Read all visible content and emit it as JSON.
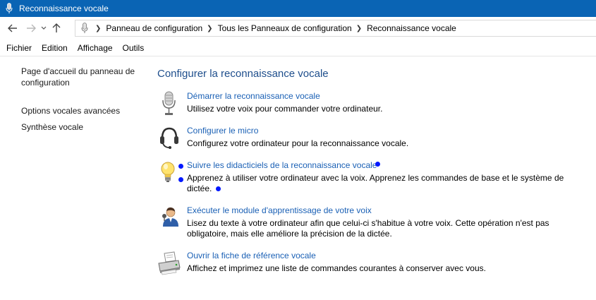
{
  "window": {
    "title": "Reconnaissance vocale"
  },
  "breadcrumb": [
    "Panneau de configuration",
    "Tous les Panneaux de configuration",
    "Reconnaissance vocale"
  ],
  "menu": [
    "Fichier",
    "Edition",
    "Affichage",
    "Outils"
  ],
  "sidebar": {
    "items": [
      {
        "label": "Page d'accueil du panneau de configuration"
      },
      {
        "label": "Options vocales avancées"
      },
      {
        "label": "Synthèse vocale"
      }
    ]
  },
  "main": {
    "heading": "Configurer la reconnaissance vocale",
    "tasks": [
      {
        "icon": "microphone-icon",
        "link": "Démarrer la reconnaissance vocale",
        "desc": "Utilisez votre voix pour commander votre ordinateur."
      },
      {
        "icon": "headset-icon",
        "link": "Configurer le micro",
        "desc": "Configurez votre ordinateur pour la reconnaissance vocale."
      },
      {
        "icon": "lightbulb-icon",
        "link": "Suivre les didacticiels de la reconnaissance vocale",
        "desc": "Apprenez à utiliser votre ordinateur avec la voix. Apprenez les commandes de base et le système de dictée."
      },
      {
        "icon": "voice-training-icon",
        "link": "Exécuter le module d'apprentissage de votre voix",
        "desc": "Lisez du texte à votre ordinateur afin que celui-ci s'habitue à votre voix. Cette opération n'est pas obligatoire, mais elle améliore la précision de la dictée."
      },
      {
        "icon": "printer-icon",
        "link": "Ouvrir la fiche de référence vocale",
        "desc": "Affichez et imprimez une liste de commandes courantes à conserver avec vous."
      }
    ]
  },
  "colors": {
    "titlebar": "#0a64b4",
    "link": "#1a60b5",
    "heading": "#1e4e8c",
    "marker": "#0018ff"
  }
}
